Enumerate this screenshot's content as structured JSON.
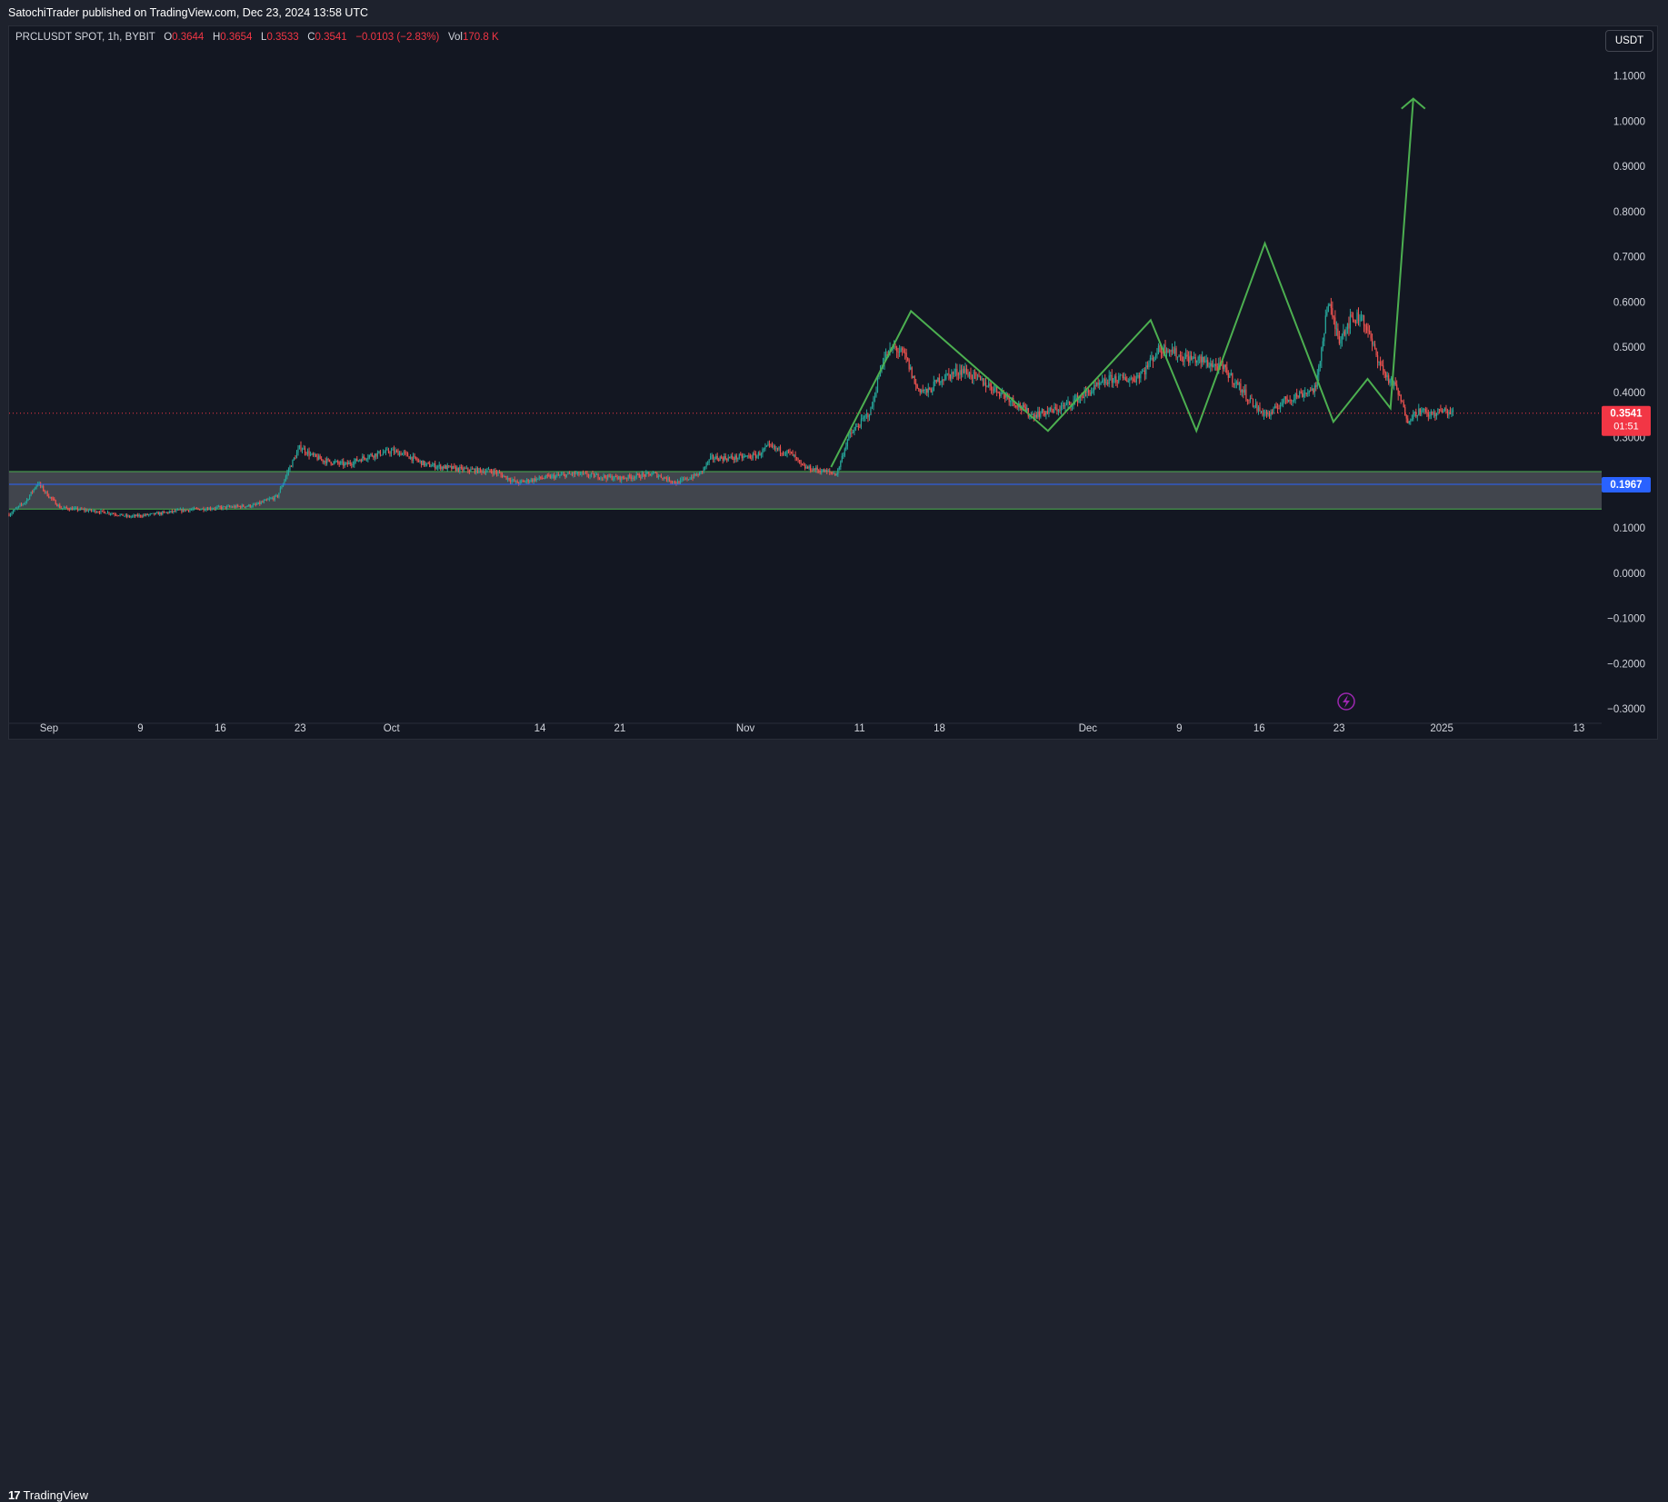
{
  "header": {
    "published_text": "SatochiTrader published on TradingView.com, Dec 23, 2024 13:58 UTC"
  },
  "legend": {
    "symbol": "PRCLUSDT SPOT, 1h, BYBIT",
    "o_label": "O",
    "o_value": "0.3644",
    "h_label": "H",
    "h_value": "0.3654",
    "l_label": "L",
    "l_value": "0.3533",
    "c_label": "C",
    "c_value": "0.3541",
    "change": "−0.0103 (−2.83%)",
    "vol_label": "Vol",
    "vol_value": "170.8 K"
  },
  "currency_button": "USDT",
  "footer": {
    "brand": "TradingView",
    "logo_mark": "17"
  },
  "colors": {
    "background": "#131722",
    "up": "#26a69a",
    "down": "#ef5350",
    "pattern_line": "#4caf50",
    "zone_fill": "#4a4d55",
    "zone_border": "#4caf50",
    "level_line": "#2962ff",
    "current_price": "#f23645"
  },
  "chart_data": {
    "type": "candlestick",
    "symbol": "PRCLUSDT",
    "interval": "1h",
    "exchange": "BYBIT",
    "y_axis": {
      "ticks": [
        "1.1000",
        "1.0000",
        "0.9000",
        "0.8000",
        "0.7000",
        "0.6000",
        "0.5000",
        "0.4000",
        "0.3000",
        "0.1000",
        "0.0000",
        "−0.1000",
        "−0.2000",
        "−0.3000"
      ],
      "tick_values": [
        1.1,
        1.0,
        0.9,
        0.8,
        0.7,
        0.6,
        0.5,
        0.4,
        0.3,
        0.1,
        0.0,
        -0.1,
        -0.2,
        -0.3
      ],
      "range": [
        -0.33,
        1.21
      ]
    },
    "x_axis": {
      "ticks": [
        "Sep",
        "9",
        "16",
        "23",
        "Oct",
        "14",
        "21",
        "Nov",
        "11",
        "18",
        "Dec",
        "9",
        "16",
        "23",
        "2025",
        "13"
      ],
      "tick_days": [
        0,
        8,
        15,
        22,
        30,
        43,
        50,
        61,
        71,
        78,
        91,
        99,
        106,
        113,
        122,
        134
      ],
      "unit": "days since Sep 1, 2024",
      "range": [
        -3.5,
        136
      ]
    },
    "current_price": {
      "value": 0.3541,
      "label": "0.3541",
      "countdown": "01:51"
    },
    "horizontal_level": {
      "value": 0.1967,
      "label": "0.1967"
    },
    "support_zone": {
      "top": 0.225,
      "bottom": 0.142
    },
    "price_path": [
      [
        -3.5,
        0.13
      ],
      [
        -2,
        0.16
      ],
      [
        -1,
        0.2
      ],
      [
        0,
        0.17
      ],
      [
        1,
        0.145
      ],
      [
        3,
        0.14
      ],
      [
        5,
        0.135
      ],
      [
        7,
        0.125
      ],
      [
        9,
        0.13
      ],
      [
        12,
        0.14
      ],
      [
        15,
        0.145
      ],
      [
        18,
        0.15
      ],
      [
        20,
        0.17
      ],
      [
        21,
        0.23
      ],
      [
        22,
        0.28
      ],
      [
        23,
        0.26
      ],
      [
        24,
        0.25
      ],
      [
        26,
        0.24
      ],
      [
        28,
        0.26
      ],
      [
        30,
        0.27
      ],
      [
        31,
        0.265
      ],
      [
        33,
        0.24
      ],
      [
        36,
        0.23
      ],
      [
        39,
        0.225
      ],
      [
        41,
        0.2
      ],
      [
        43,
        0.21
      ],
      [
        46,
        0.22
      ],
      [
        48,
        0.215
      ],
      [
        50,
        0.21
      ],
      [
        53,
        0.22
      ],
      [
        55,
        0.2
      ],
      [
        57,
        0.22
      ],
      [
        58,
        0.255
      ],
      [
        60,
        0.255
      ],
      [
        62,
        0.26
      ],
      [
        63,
        0.28
      ],
      [
        65,
        0.265
      ],
      [
        66,
        0.235
      ],
      [
        68,
        0.225
      ],
      [
        69,
        0.22
      ],
      [
        70,
        0.3
      ],
      [
        72,
        0.36
      ],
      [
        73,
        0.47
      ],
      [
        74,
        0.5
      ],
      [
        75,
        0.48
      ],
      [
        76,
        0.41
      ],
      [
        77,
        0.4
      ],
      [
        78,
        0.43
      ],
      [
        80,
        0.45
      ],
      [
        82,
        0.42
      ],
      [
        84,
        0.39
      ],
      [
        86,
        0.35
      ],
      [
        88,
        0.36
      ],
      [
        89,
        0.37
      ],
      [
        91,
        0.4
      ],
      [
        93,
        0.43
      ],
      [
        95,
        0.43
      ],
      [
        96,
        0.45
      ],
      [
        97,
        0.49
      ],
      [
        98,
        0.5
      ],
      [
        99,
        0.48
      ],
      [
        101,
        0.47
      ],
      [
        103,
        0.45
      ],
      [
        105,
        0.39
      ],
      [
        106,
        0.36
      ],
      [
        107,
        0.35
      ],
      [
        108,
        0.38
      ],
      [
        110,
        0.4
      ],
      [
        111,
        0.41
      ],
      [
        112,
        0.6
      ],
      [
        113,
        0.52
      ],
      [
        114,
        0.56
      ],
      [
        115,
        0.57
      ],
      [
        116,
        0.5
      ],
      [
        117,
        0.44
      ],
      [
        118,
        0.41
      ],
      [
        119,
        0.34
      ],
      [
        120,
        0.36
      ],
      [
        121,
        0.35
      ],
      [
        122,
        0.36
      ],
      [
        123,
        0.3541
      ]
    ],
    "pattern_lines": [
      {
        "name": "projection",
        "points": [
          [
            68.5,
            0.235
          ],
          [
            75.5,
            0.58
          ],
          [
            87.5,
            0.315
          ],
          [
            96.5,
            0.56
          ],
          [
            100.5,
            0.315
          ],
          [
            106.5,
            0.73
          ],
          [
            112.5,
            0.335
          ],
          [
            115.5,
            0.43
          ],
          [
            117.5,
            0.365
          ],
          [
            119.5,
            1.05
          ]
        ]
      }
    ],
    "projection_arrow": {
      "tip": [
        119.5,
        1.05
      ]
    }
  }
}
